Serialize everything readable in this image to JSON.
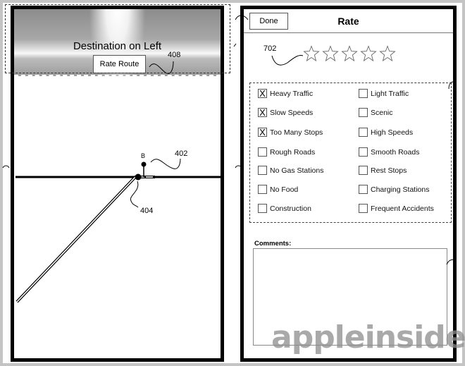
{
  "left_screen": {
    "banner_title": "Destination on Left",
    "rate_route_button": "Rate Route",
    "map_marker_label": "B",
    "ref_numbers": {
      "banner": "408",
      "marker": "402",
      "position": "404"
    }
  },
  "right_screen": {
    "done_button": "Done",
    "title": "Rate",
    "rating": {
      "ref": "702",
      "max_stars": 5,
      "selected_stars": 0
    },
    "options_left": [
      {
        "label": "Heavy Traffic",
        "checked": true,
        "mark": "X"
      },
      {
        "label": "Slow Speeds",
        "checked": true,
        "mark": "X"
      },
      {
        "label": "Too Many Stops",
        "checked": true,
        "mark": "X"
      },
      {
        "label": "Rough Roads",
        "checked": false,
        "mark": ""
      },
      {
        "label": "No Gas Stations",
        "checked": false,
        "mark": ""
      },
      {
        "label": "No Food",
        "checked": false,
        "mark": ""
      },
      {
        "label": "Construction",
        "checked": false,
        "mark": ""
      }
    ],
    "options_right": [
      {
        "label": "Light Traffic",
        "checked": false,
        "mark": ""
      },
      {
        "label": "Scenic",
        "checked": false,
        "mark": ""
      },
      {
        "label": "High Speeds",
        "checked": false,
        "mark": ""
      },
      {
        "label": "Smooth Roads",
        "checked": false,
        "mark": ""
      },
      {
        "label": "Rest Stops",
        "checked": false,
        "mark": ""
      },
      {
        "label": "Charging Stations",
        "checked": false,
        "mark": ""
      },
      {
        "label": "Frequent Accidents",
        "checked": false,
        "mark": ""
      }
    ],
    "comments_label": "Comments:",
    "comments_value": ""
  },
  "watermark": "appleinsider"
}
